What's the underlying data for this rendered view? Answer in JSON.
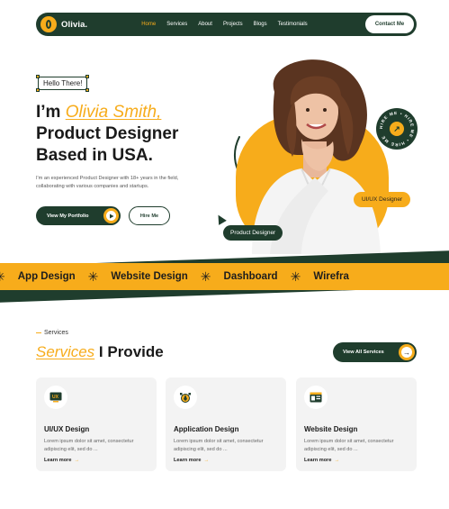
{
  "nav": {
    "logo": "Olivia.",
    "items": [
      "Home",
      "Services",
      "About",
      "Projects",
      "Blogs",
      "Testimonials"
    ],
    "active": "Home",
    "contact": "Contact Me"
  },
  "hero": {
    "hello": "Hello There!",
    "title_prefix": "I’m ",
    "name": "Olivia Smith,",
    "title_line2": "Product Designer",
    "title_line3": "Based in USA.",
    "description": "I'm an experienced Product Designer with 18+ years in the field, collaborating with various companies and startups.",
    "portfolio_btn": "View My Portfolio",
    "hire_btn": "Hire Me",
    "badge_role": "UI/UX Designer",
    "badge_pd": "Product Designer",
    "circle_text": "HIRE ME • HIRE ME • HIRE ME"
  },
  "marquee": {
    "items": [
      "App Design",
      "Website Design",
      "Dashboard",
      "Wirefra"
    ]
  },
  "services": {
    "tag": "Services",
    "title_hl": "Services",
    "title_rest": " I Provide",
    "view_all": "View All Services",
    "cards": [
      {
        "title": "UI/UX Design",
        "desc": "Lorem ipsum dolor sit amet, consectetur adipiscing elit, sed do ...",
        "link": "Learn more",
        "icon": "ux-icon"
      },
      {
        "title": "Application Design",
        "desc": "Lorem ipsum dolor sit amet, consectetur adipiscing elit, sed do ...",
        "link": "Learn more",
        "icon": "pen-tool-icon"
      },
      {
        "title": "Website Design",
        "desc": "Lorem ipsum dolor sit amet, consectetur adipiscing elit, sed do ...",
        "link": "Learn more",
        "icon": "browser-layout-icon"
      }
    ]
  },
  "colors": {
    "accent": "#f7ac1b",
    "dark": "#1f3d2d"
  }
}
